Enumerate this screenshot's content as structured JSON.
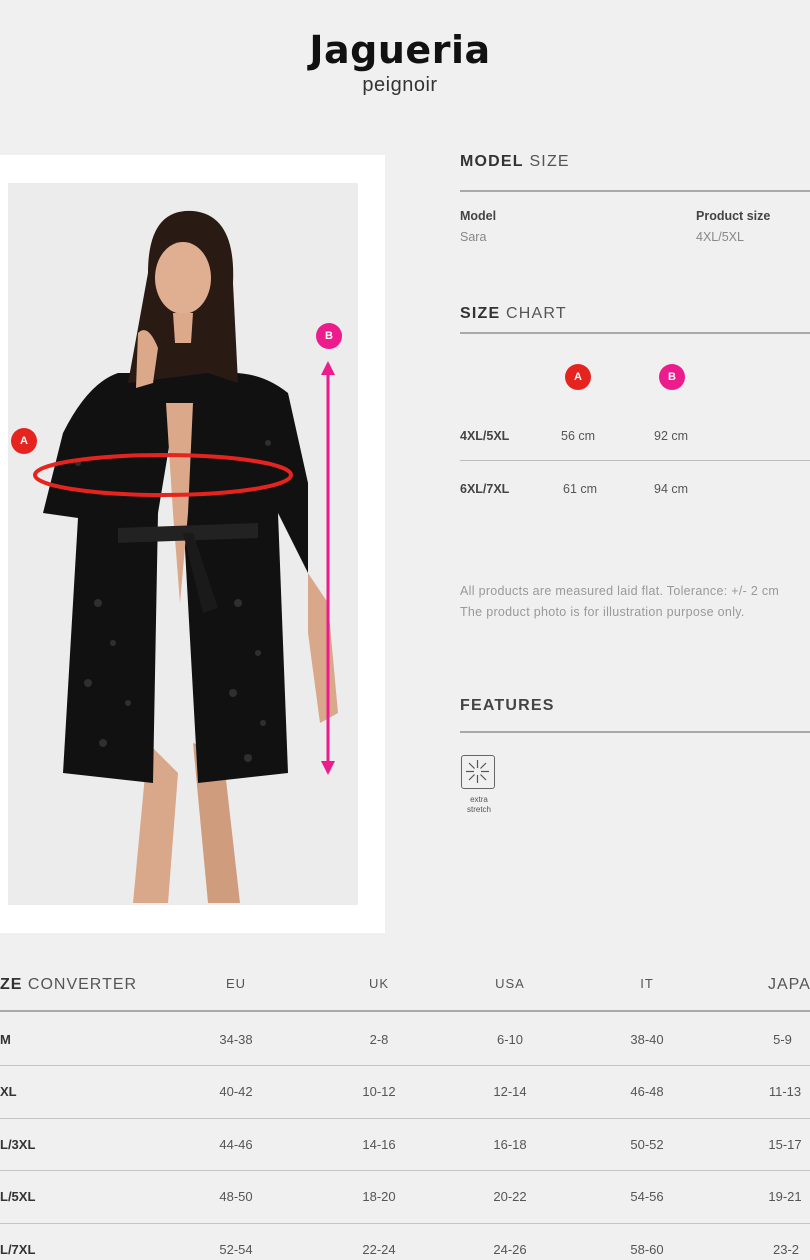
{
  "header": {
    "title": "Jagueria",
    "subtitle": "peignoir"
  },
  "measure_markers": {
    "a": "A",
    "b": "B"
  },
  "model_size": {
    "heading_bold": "MODEL",
    "heading_light": "SIZE",
    "model_label": "Model",
    "model_value": "Sara",
    "product_size_label": "Product size",
    "product_size_value": "4XL/5XL"
  },
  "size_chart": {
    "heading_bold": "SIZE",
    "heading_light": "CHART",
    "columns": [
      "A",
      "B"
    ],
    "rows": [
      {
        "size": "4XL/5XL",
        "a": "56 cm",
        "b": "92 cm"
      },
      {
        "size": "6XL/7XL",
        "a": "61 cm",
        "b": "94 cm"
      }
    ],
    "note_line1": "All products are measured laid flat. Tolerance: +/- 2 cm",
    "note_line2": "The product photo is for illustration purpose only."
  },
  "features": {
    "heading": "FEATURES",
    "items": [
      {
        "icon": "extra-stretch-icon",
        "label_line1": "extra",
        "label_line2": "stretch"
      }
    ]
  },
  "size_converter": {
    "heading_bold": "ZE",
    "heading_light": "CONVERTER",
    "columns": [
      "EU",
      "UK",
      "USA",
      "IT",
      "JAPA"
    ],
    "rows": [
      {
        "size": "M",
        "eu": "34-38",
        "uk": "2-8",
        "usa": "6-10",
        "it": "38-40",
        "japan": "5-9"
      },
      {
        "size": "XL",
        "eu": "40-42",
        "uk": "10-12",
        "usa": "12-14",
        "it": "46-48",
        "japan": "11-13"
      },
      {
        "size": "L/3XL",
        "eu": "44-46",
        "uk": "14-16",
        "usa": "16-18",
        "it": "50-52",
        "japan": "15-17"
      },
      {
        "size": "L/5XL",
        "eu": "48-50",
        "uk": "18-20",
        "usa": "20-22",
        "it": "54-56",
        "japan": "19-21"
      },
      {
        "size": "L/7XL",
        "eu": "52-54",
        "uk": "22-24",
        "usa": "24-26",
        "it": "58-60",
        "japan": "23-2"
      }
    ]
  },
  "colors": {
    "marker_a": "#e52420",
    "marker_b": "#ec1c8c",
    "background": "#f0f0f0"
  }
}
